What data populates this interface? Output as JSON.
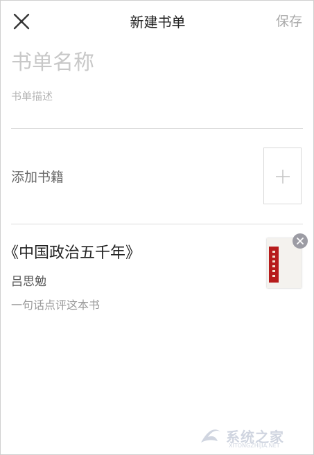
{
  "header": {
    "title": "新建书单",
    "save_label": "保存"
  },
  "form": {
    "name_placeholder": "书单名称",
    "description_placeholder": "书单描述"
  },
  "add_books": {
    "label": "添加书籍"
  },
  "books": [
    {
      "title": "《中国政治五千年》",
      "author": "吕思勉",
      "comment_placeholder": "一句话点评这本书",
      "cover_color": "#b71c1c"
    }
  ],
  "watermark": {
    "text": "系统之家",
    "url": "XITONGZHIJIA.NET"
  },
  "icons": {
    "close": "close-icon",
    "add": "plus-icon",
    "remove": "remove-icon"
  }
}
